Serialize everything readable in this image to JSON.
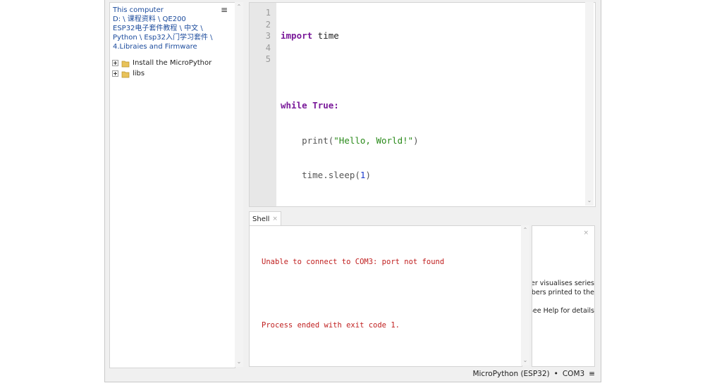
{
  "files": {
    "breadcrumb": [
      "This computer",
      "D: \\ 课程资料 \\ QE200",
      "ESP32电子套件教程 \\ 中文 \\",
      "Python \\ Esp32入门学习套件 \\",
      "4.Libraies and Firmware"
    ],
    "menu_icon": "≡",
    "items": [
      {
        "label": "Install the MicroPythor",
        "icon": "folder-icon"
      },
      {
        "label": "libs",
        "icon": "folder-icon"
      }
    ]
  },
  "editor": {
    "line_numbers": [
      "1",
      "2",
      "3",
      "4",
      "5"
    ],
    "code": {
      "l1_kw": "import",
      "l1_rest": " time",
      "l3_kw": "while",
      "l3_val": "True",
      "l3_rest": ":",
      "l4_indent": "    ",
      "l4_fn": "print(",
      "l4_str": "\"Hello, World!\"",
      "l4_end": ")",
      "l5_indent": "    ",
      "l5_fn": "time.sleep(",
      "l5_num": "1",
      "l5_end": ")"
    }
  },
  "shell": {
    "tab_label": "Shell",
    "tab_close": "×",
    "lines": [
      "Unable to connect to COM3: port not found",
      "",
      "Process ended with exit code 1."
    ]
  },
  "plotter": {
    "close": "×",
    "line1": "tter visualises series",
    "line2": "bers printed to the",
    "line3": "See Help for details"
  },
  "status": {
    "interpreter": "MicroPython (ESP32)",
    "separator": "•",
    "port": "COM3",
    "menu": "≡"
  },
  "colors": {
    "keyword": "#7a1a9a",
    "string": "#2a8a1a",
    "number": "#1a3acc",
    "error": "#c02020",
    "path": "#1a4a9c"
  }
}
